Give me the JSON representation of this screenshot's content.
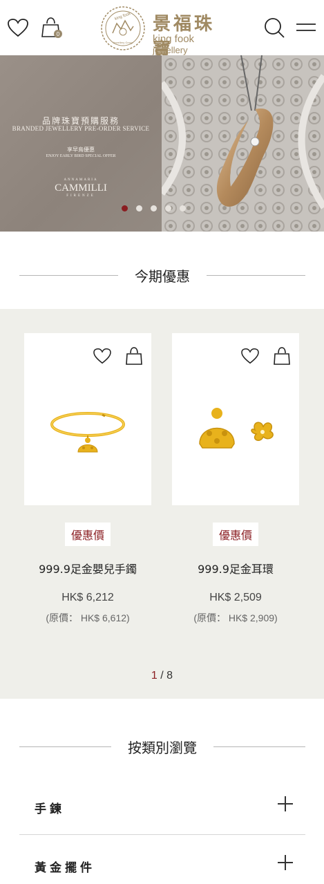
{
  "header": {
    "logo_cn": "景福珠寶",
    "logo_en_brand": "king fook",
    "logo_en_suffix": "jewellery",
    "logo_seal_text": "king fook",
    "logo_seal_bottom": "Jewellery Group",
    "icons": [
      "heart-icon",
      "bag-icon",
      "search-icon",
      "menu-icon"
    ],
    "cart_count": "0"
  },
  "banner": {
    "title_cn": "品牌珠寶預購服務",
    "title_en": "BRANDED JEWELLERY PRE-ORDER SERVICE",
    "sub_cn": "享早鳥優惠",
    "sub_en": "ENJOY EARLY BIRD SPECIAL OFFER",
    "brand_small": "ANNAMARIA",
    "brand": "CAMMILLI",
    "brand_sub": "FIRENZE",
    "slides": 5,
    "active_slide": 1
  },
  "offers": {
    "title": "今期優惠",
    "products": [
      {
        "badge": "優惠價",
        "name": "999.9足金嬰兒手鐲",
        "price": "HK$ 6,212",
        "original": "(原價： HK$ 6,612)"
      },
      {
        "badge": "優惠價",
        "name": "999.9足金耳環",
        "price": "HK$ 2,509",
        "original": "(原價： HK$ 2,909)"
      }
    ],
    "pager_current": "1",
    "pager_total": " / 8"
  },
  "browse": {
    "title": "按類別瀏覽",
    "categories": [
      "手鍊",
      "黃金擺件"
    ]
  },
  "colors": {
    "accent": "#8a1d21",
    "gold": "#a08a63",
    "offer_bg": "#efefea"
  }
}
